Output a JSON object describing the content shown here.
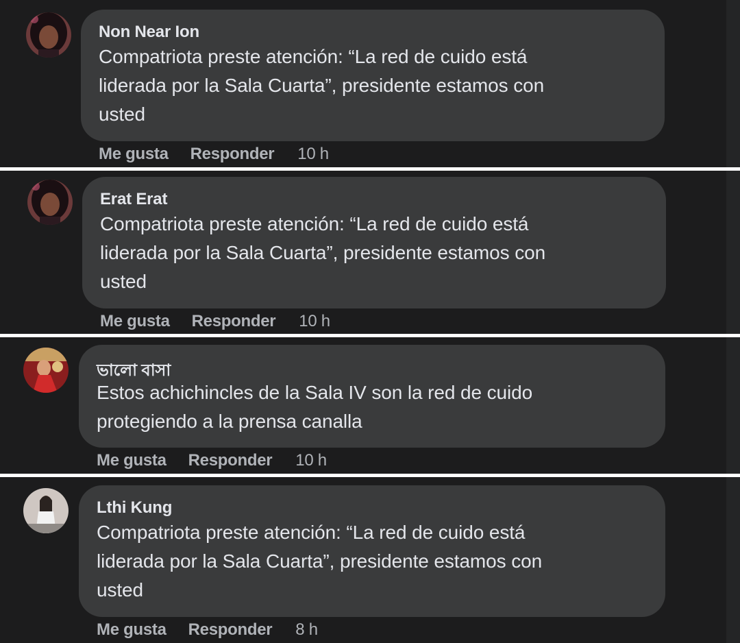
{
  "comments": [
    {
      "author": "Non Near Ion",
      "text": "Compatriota preste atención: “La red de cuido está\nliderada por la Sala Cuarta”, presidente estamos con\nusted",
      "like_label": "Me gusta",
      "reply_label": "Responder",
      "time": "10 h",
      "avatar_icon": "profile-photo-dark-hair"
    },
    {
      "author": "Erat Erat",
      "text": "Compatriota preste atención: “La red de cuido está\nliderada por la Sala Cuarta”, presidente estamos con\nusted",
      "like_label": "Me gusta",
      "reply_label": "Responder",
      "time": "10 h",
      "avatar_icon": "profile-photo-dark-hair"
    },
    {
      "author": "ভালো বাসা",
      "text": "Estos achichincles de la Sala IV son la red de cuido\nprotegiendo a la prensa canalla",
      "like_label": "Me gusta",
      "reply_label": "Responder",
      "time": "10 h",
      "avatar_icon": "profile-photo-red-costume"
    },
    {
      "author": "Lthi Kung",
      "text": "Compatriota preste atención: “La red de cuido está\nliderada por la Sala Cuarta”, presidente estamos con\nusted",
      "like_label": "Me gusta",
      "reply_label": "Responder",
      "time": "8 h",
      "avatar_icon": "profile-photo-light-outfit"
    }
  ],
  "colors": {
    "background": "#1c1c1d",
    "bubble": "#3a3b3c",
    "primary_text": "#e4e6eb",
    "secondary_text": "#b0b3b8",
    "separator": "#ffffff"
  }
}
